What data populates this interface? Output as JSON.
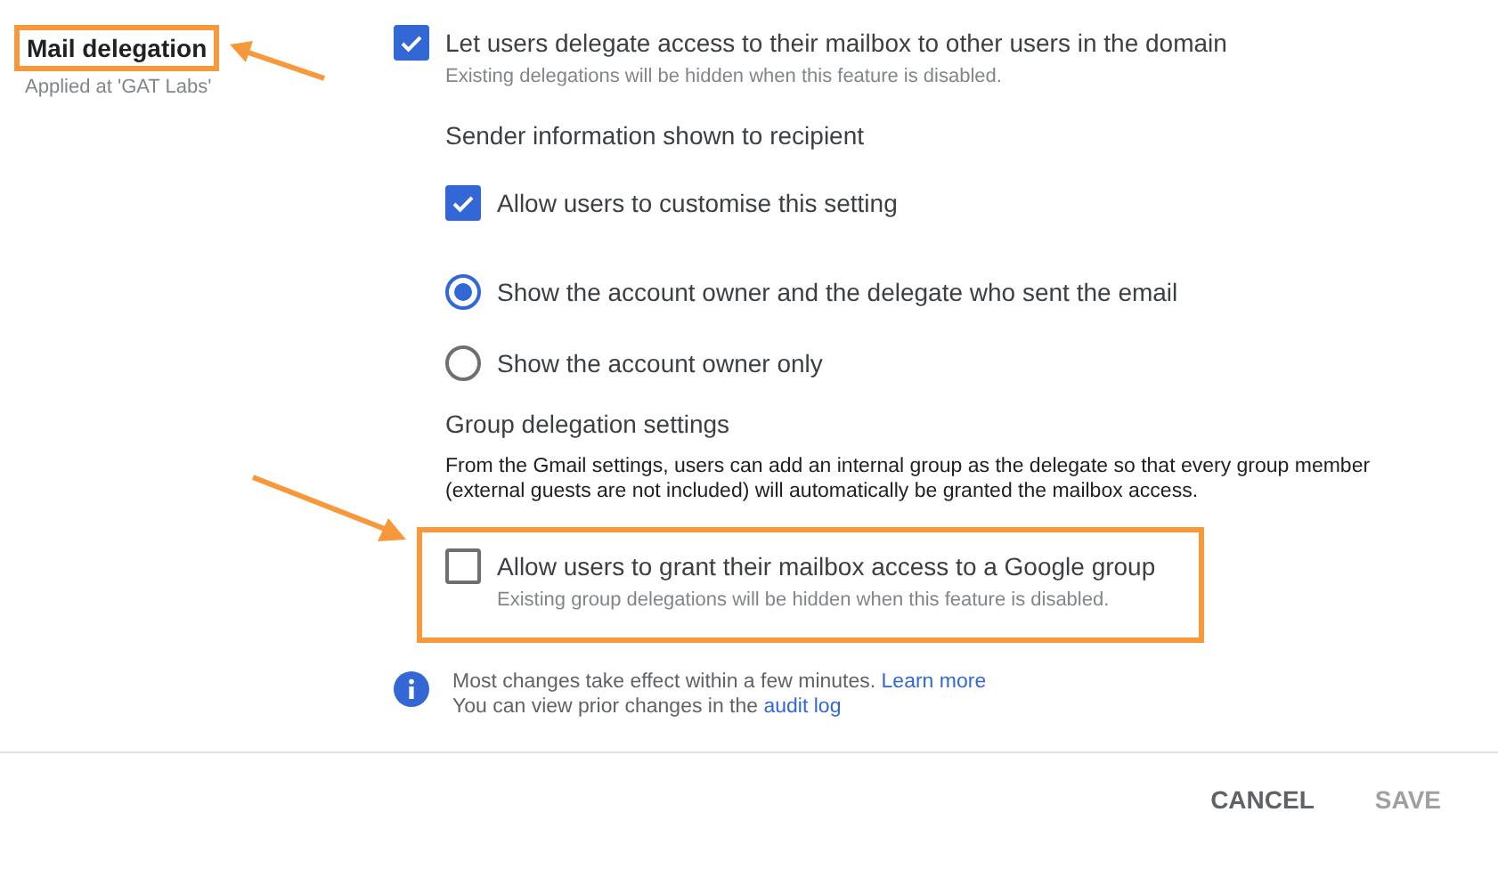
{
  "section": {
    "title": "Mail delegation",
    "scope": "Applied at 'GAT Labs'",
    "highlighted": true
  },
  "delegation": {
    "label": "Let users delegate access to their mailbox to other users in the domain",
    "checked": true,
    "hint": "Existing delegations will be hidden when this feature is disabled."
  },
  "sender_info": {
    "heading": "Sender information shown to recipient",
    "customise": {
      "label": "Allow users to customise this setting",
      "checked": true
    },
    "options": [
      {
        "label": "Show the account owner and the delegate who sent the email",
        "selected": true
      },
      {
        "label": "Show the account owner only",
        "selected": false
      }
    ]
  },
  "group_delegation": {
    "heading": "Group delegation settings",
    "description": "From the Gmail settings, users can add an internal group as the delegate so that every group member (external guests are not included) will automatically be granted the mailbox access.",
    "allow": {
      "label": "Allow users to grant their mailbox access to a Google group",
      "checked": false,
      "hint": "Existing group delegations will be hidden when this feature is disabled.",
      "highlighted": true
    }
  },
  "info": [
    {
      "text": "Most changes take effect within a few minutes.",
      "link": "Learn more"
    },
    {
      "text": "You can view prior changes in the",
      "link": "audit log"
    }
  ],
  "buttons": [
    {
      "label": "CANCEL",
      "disabled": false
    },
    {
      "label": "SAVE",
      "disabled": true
    }
  ]
}
